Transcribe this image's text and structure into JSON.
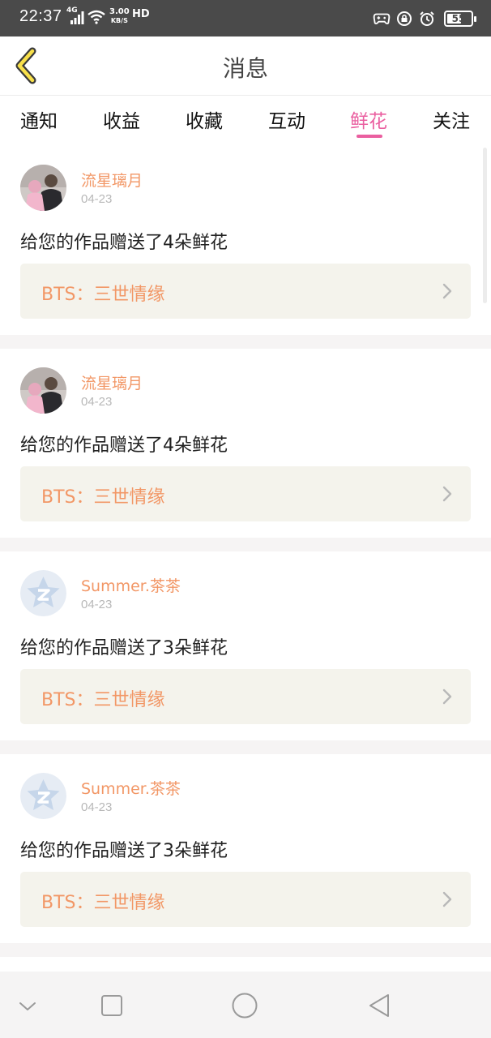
{
  "status_bar": {
    "time": "22:37",
    "network": "4G",
    "speed_value": "3.00",
    "speed_unit": "KB/S",
    "hd": "HD",
    "battery": "55"
  },
  "header": {
    "title": "消息",
    "back_icon": "chevron-left-icon"
  },
  "tabs": [
    {
      "label": "通知",
      "active": false
    },
    {
      "label": "收益",
      "active": false
    },
    {
      "label": "收藏",
      "active": false
    },
    {
      "label": "互动",
      "active": false
    },
    {
      "label": "鲜花",
      "active": true
    },
    {
      "label": "关注",
      "active": false
    }
  ],
  "colors": {
    "accent": "#ea5fa0",
    "username": "#f29766",
    "link_background": "#f4f3ec"
  },
  "notifications": [
    {
      "user": "流星璃月",
      "date": "04-23",
      "message": "给您的作品赠送了4朵鲜花",
      "work": "BTS：三世情缘",
      "avatar": "photo-avatar"
    },
    {
      "user": "流星璃月",
      "date": "04-23",
      "message": "给您的作品赠送了4朵鲜花",
      "work": "BTS：三世情缘",
      "avatar": "photo-avatar"
    },
    {
      "user": "Summer.茶茶",
      "date": "04-23",
      "message": "给您的作品赠送了3朵鲜花",
      "work": "BTS：三世情缘",
      "avatar": "qzone-default-avatar"
    },
    {
      "user": "Summer.茶茶",
      "date": "04-23",
      "message": "给您的作品赠送了3朵鲜花",
      "work": "BTS：三世情缘",
      "avatar": "qzone-default-avatar"
    }
  ],
  "navbar": {
    "icons": [
      "chevron-down-icon",
      "square-icon",
      "circle-icon",
      "triangle-back-icon"
    ]
  }
}
